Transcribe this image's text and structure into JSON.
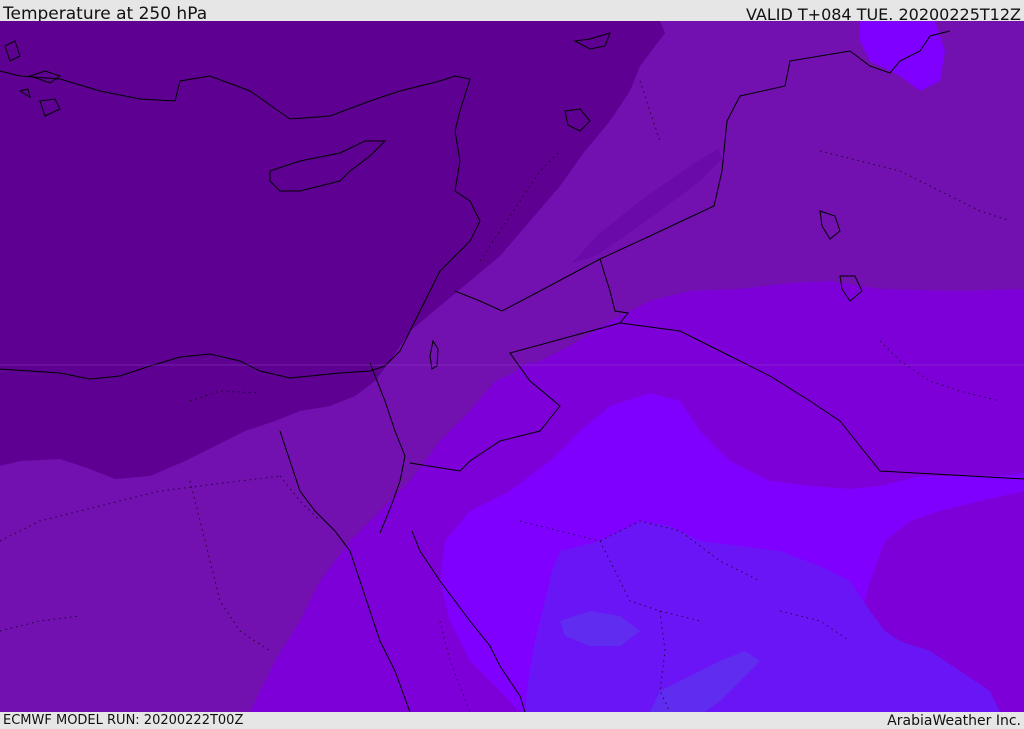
{
  "header": {
    "title": "Temperature at 250 hPa",
    "valid": "VALID T+084 TUE. 20200225T12Z"
  },
  "footer": {
    "model_run": "ECMWF MODEL RUN: 20200222T00Z",
    "credit": "ArabiaWeather Inc."
  },
  "map": {
    "colors": {
      "coldest": "#5e0091",
      "cold": "#7210b0",
      "mid": "#7e00d8",
      "warm": "#8000ff",
      "warmer": "#6a15f5",
      "warmest": "#5f2cf0",
      "coastline": "#000000"
    }
  }
}
